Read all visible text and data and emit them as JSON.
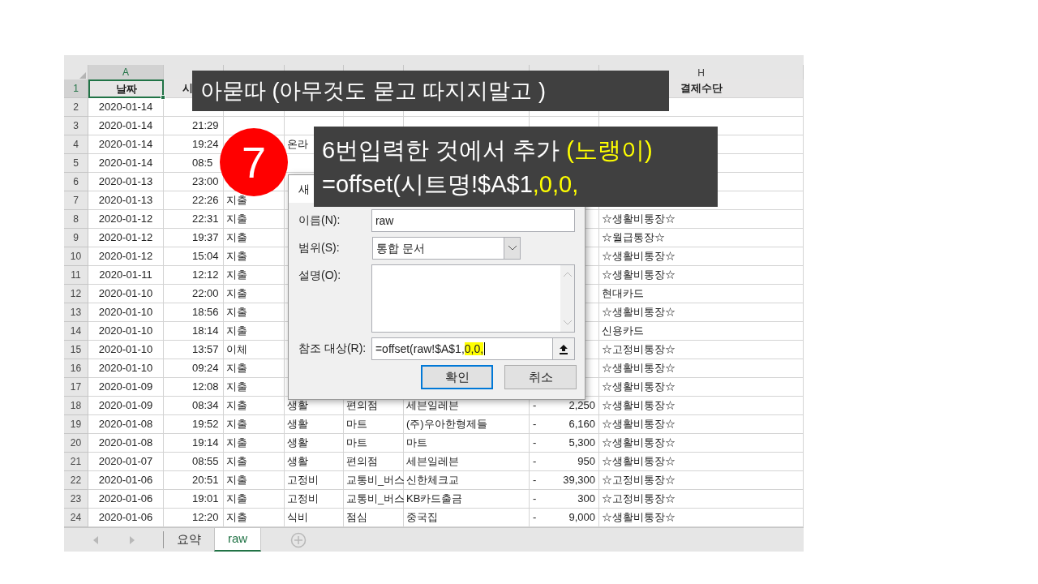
{
  "sheet": {
    "column_letters": {
      "date": "A",
      "payment": "H"
    },
    "header_row": {
      "date": "날짜",
      "time": "시",
      "payment": "결제수단",
      "selected": true
    },
    "rows": [
      {
        "date": "2020-01-14",
        "time": "",
        "type": "",
        "category": "",
        "subcategory": "",
        "merchant": "",
        "sign": "",
        "amount": "",
        "payment": ""
      },
      {
        "date": "2020-01-14",
        "time": "21:29",
        "type": "",
        "category": "",
        "subcategory": "",
        "merchant": "",
        "sign": "",
        "amount": "",
        "payment": ""
      },
      {
        "date": "2020-01-14",
        "time": "19:24",
        "type": "",
        "category": "온라",
        "subcategory": "",
        "merchant": "",
        "sign": "",
        "amount": "",
        "payment": ""
      },
      {
        "date": "2020-01-14",
        "time": "08:5",
        "type": "",
        "category": "",
        "subcategory": "",
        "merchant": "",
        "sign": "",
        "amount": "",
        "payment": ""
      },
      {
        "date": "2020-01-13",
        "time": "23:00",
        "type": "",
        "category": "",
        "subcategory": "",
        "merchant": "",
        "sign": "",
        "amount": "",
        "payment": ""
      },
      {
        "date": "2020-01-13",
        "time": "22:26",
        "type": "지출",
        "category": "",
        "subcategory": "",
        "merchant": "",
        "sign": "",
        "amount": "",
        "payment": ""
      },
      {
        "date": "2020-01-12",
        "time": "22:31",
        "type": "지출",
        "category": "",
        "subcategory": "",
        "merchant": "",
        "sign": "",
        "amount": "",
        "payment": "☆생활비통장☆"
      },
      {
        "date": "2020-01-12",
        "time": "19:37",
        "type": "지출",
        "category": "",
        "subcategory": "",
        "merchant": "",
        "sign": "",
        "amount": "",
        "payment": "☆월급통장☆"
      },
      {
        "date": "2020-01-12",
        "time": "15:04",
        "type": "지출",
        "category": "",
        "subcategory": "",
        "merchant": "",
        "sign": "",
        "amount": "",
        "payment": "☆생활비통장☆"
      },
      {
        "date": "2020-01-11",
        "time": "12:12",
        "type": "지출",
        "category": "",
        "subcategory": "",
        "merchant": "",
        "sign": "",
        "amount": "",
        "payment": "☆생활비통장☆"
      },
      {
        "date": "2020-01-10",
        "time": "22:00",
        "type": "지출",
        "category": "",
        "subcategory": "",
        "merchant": "",
        "sign": "",
        "amount": "",
        "payment": "현대카드"
      },
      {
        "date": "2020-01-10",
        "time": "18:56",
        "type": "지출",
        "category": "",
        "subcategory": "",
        "merchant": "",
        "sign": "",
        "amount": "",
        "payment": "☆생활비통장☆"
      },
      {
        "date": "2020-01-10",
        "time": "18:14",
        "type": "지출",
        "category": "",
        "subcategory": "",
        "merchant": "",
        "sign": "",
        "amount": "",
        "payment": "신용카드"
      },
      {
        "date": "2020-01-10",
        "time": "13:57",
        "type": "이체",
        "category": "",
        "subcategory": "",
        "merchant": "",
        "sign": "",
        "amount": "",
        "payment": "☆고정비통장☆"
      },
      {
        "date": "2020-01-10",
        "time": "09:24",
        "type": "지출",
        "category": "",
        "subcategory": "",
        "merchant": "",
        "sign": "",
        "amount": "",
        "payment": "☆생활비통장☆"
      },
      {
        "date": "2020-01-09",
        "time": "12:08",
        "type": "지출",
        "category": "",
        "subcategory": "",
        "merchant": "",
        "sign": "",
        "amount": "",
        "payment": "☆생활비통장☆"
      },
      {
        "date": "2020-01-09",
        "time": "08:34",
        "type": "지출",
        "category": "생활",
        "subcategory": "편의점",
        "merchant": "세븐일레븐",
        "sign": "-",
        "amount": "2,250",
        "payment": "☆생활비통장☆"
      },
      {
        "date": "2020-01-08",
        "time": "19:52",
        "type": "지출",
        "category": "생활",
        "subcategory": "마트",
        "merchant": "(주)우아한형제들",
        "sign": "-",
        "amount": "6,160",
        "payment": "☆생활비통장☆"
      },
      {
        "date": "2020-01-08",
        "time": "19:14",
        "type": "지출",
        "category": "생활",
        "subcategory": "마트",
        "merchant": "마트",
        "sign": "-",
        "amount": "5,300",
        "payment": "☆생활비통장☆"
      },
      {
        "date": "2020-01-07",
        "time": "08:55",
        "type": "지출",
        "category": "생활",
        "subcategory": "편의점",
        "merchant": "세븐일레븐",
        "sign": "-",
        "amount": "950",
        "payment": "☆생활비통장☆"
      },
      {
        "date": "2020-01-06",
        "time": "20:51",
        "type": "지출",
        "category": "고정비",
        "subcategory": "교통비_버스",
        "merchant": "신한체크교",
        "sign": "-",
        "amount": "39,300",
        "payment": "☆고정비통장☆"
      },
      {
        "date": "2020-01-06",
        "time": "19:01",
        "type": "지출",
        "category": "고정비",
        "subcategory": "교통비_버스",
        "merchant": "KB카드출금",
        "sign": "-",
        "amount": "300",
        "payment": "☆고정비통장☆"
      },
      {
        "date": "2020-01-06",
        "time": "12:20",
        "type": "지출",
        "category": "식비",
        "subcategory": "점심",
        "merchant": "중국집",
        "sign": "-",
        "amount": "9,000",
        "payment": "☆생활비통장☆"
      }
    ],
    "row_numbers": [
      "1",
      "2",
      "3",
      "4",
      "5",
      "6",
      "7",
      "8",
      "9",
      "10",
      "11",
      "12",
      "13",
      "14",
      "15",
      "16",
      "17",
      "18",
      "19",
      "20",
      "21",
      "22",
      "23",
      "24"
    ],
    "tabs": [
      {
        "label": "요약",
        "selected": false
      },
      {
        "label": "raw",
        "selected": true
      }
    ]
  },
  "dialog": {
    "title": "새",
    "fields": [
      {
        "kind": "input",
        "label": "이름(N):",
        "value": "raw"
      },
      {
        "kind": "select",
        "label": "범위(S):",
        "value": "통합 문서"
      },
      {
        "kind": "textarea",
        "label": "설명(O):"
      },
      {
        "kind": "reference",
        "label": "참조 대상(R):",
        "value": "=offset(raw!$A$1,",
        "highlighted": "0,0,"
      }
    ],
    "buttons": [
      {
        "label": "확인",
        "default": true
      },
      {
        "label": "취소",
        "default": false
      }
    ]
  },
  "callouts": [
    {
      "kind": "banner",
      "text": "아묻따 (아무것도 묻고 따지지말고 )"
    },
    {
      "kind": "step",
      "text": "7"
    },
    {
      "kind": "note",
      "lines": [
        {
          "text": "6번입력한 것에서 추가 ",
          "highlight": "(노랭이)"
        },
        {
          "text": "=offset(시트명!$A$1",
          "highlight": ",0,0,"
        }
      ]
    }
  ]
}
